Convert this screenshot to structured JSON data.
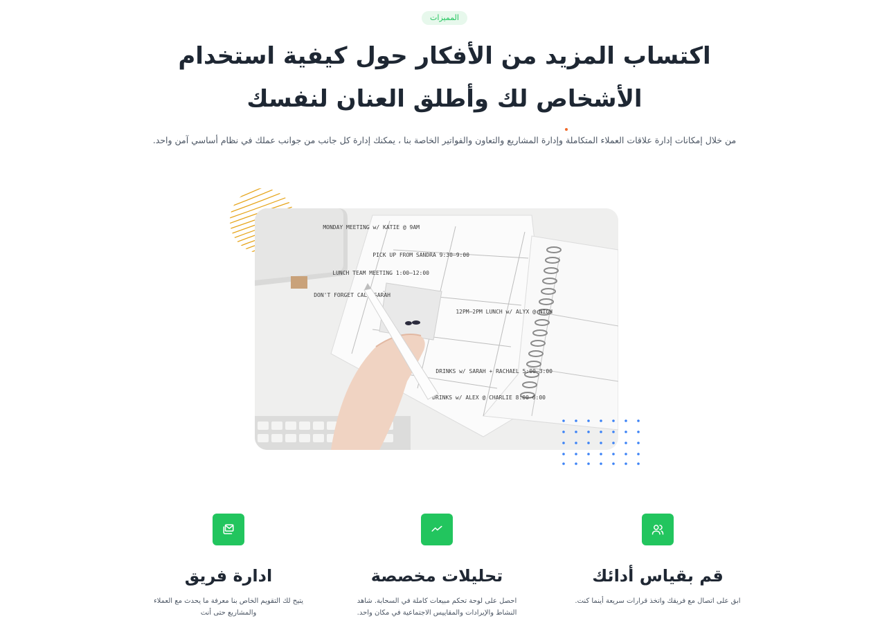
{
  "section": {
    "badge": "المميزات",
    "title": "اكتساب المزيد من الأفكار حول كيفية استخدام الأشخاص لك وأطلق العنان لنفسك",
    "subtitle": "من خلال إمكانات إدارة علاقات العملاء المتكاملة وإدارة المشاريع والتعاون والفواتير الخاصة بنا ، يمكنك إدارة كل جانب من جوانب عملك في نظام أساسي آمن واحد."
  },
  "colors": {
    "accent_green": "#22c55e",
    "badge_bg": "#e7f8ec",
    "heading": "#1e2733",
    "stripe_circle": "#e6a419",
    "dot_grid": "#3b82f6",
    "dot_accent": "#f06a2b"
  },
  "photo_notes": {
    "note1": "MONDAY MEETING w/ KATIE @ 9AM",
    "note2": "9:00–9:30 PICK UP FROM SANDRA",
    "note3": "12:00–1:00 LUNCH TEAM MEETING",
    "note4": "DON'T FORGET CALL SARAH",
    "note5": "12PM–2PM LUNCH w/ ALYX @ NIGH",
    "note6": "3:00–5:00 DRINKS w/ SARAH + RACHAEL",
    "note7": "6:00–8:00 DRINKS w/ ALEX @ CHARLIE"
  },
  "features": [
    {
      "icon": "users-icon",
      "title": "قم بقياس أدائك",
      "text": "ابق على اتصال مع فريقك واتخذ قرارات سريعة أينما كنت."
    },
    {
      "icon": "trend-line-icon",
      "title": "تحليلات مخصصة",
      "text": "احصل على لوحة تحكم مبيعات كاملة في السحابة. شاهد النشاط والإيرادات والمقاييس الاجتماعية في مكان واحد."
    },
    {
      "icon": "mail-stack-icon",
      "title": "ادارة فريق",
      "text": "يتيح لك التقويم الخاص بنا معرفة ما يحدث مع العملاء والمشاريع حتى أنت"
    }
  ]
}
